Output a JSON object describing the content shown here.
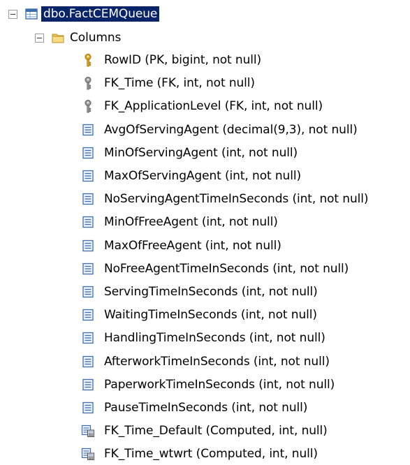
{
  "tree": {
    "table_node": {
      "label": "dbo.FactCEMQueue",
      "icon": "table-icon",
      "expanded": true,
      "selected": true
    },
    "columns_folder": {
      "label": "Columns",
      "icon": "folder-icon",
      "expanded": true
    },
    "columns": [
      {
        "label": "RowID (PK, bigint, not null)",
        "icon": "primary-key-icon"
      },
      {
        "label": "FK_Time (FK, int, not null)",
        "icon": "foreign-key-icon"
      },
      {
        "label": "FK_ApplicationLevel (FK, int, not null)",
        "icon": "foreign-key-icon"
      },
      {
        "label": "AvgOfServingAgent (decimal(9,3), not null)",
        "icon": "column-icon"
      },
      {
        "label": "MinOfServingAgent (int, not null)",
        "icon": "column-icon"
      },
      {
        "label": "MaxOfServingAgent (int, not null)",
        "icon": "column-icon"
      },
      {
        "label": "NoServingAgentTimeInSeconds (int, not null)",
        "icon": "column-icon"
      },
      {
        "label": "MinOfFreeAgent (int, not null)",
        "icon": "column-icon"
      },
      {
        "label": "MaxOfFreeAgent (int, not null)",
        "icon": "column-icon"
      },
      {
        "label": "NoFreeAgentTimeInSeconds (int, not null)",
        "icon": "column-icon"
      },
      {
        "label": "ServingTimeInSeconds (int, not null)",
        "icon": "column-icon"
      },
      {
        "label": "WaitingTimeInSeconds (int, not null)",
        "icon": "column-icon"
      },
      {
        "label": "HandlingTimeInSeconds (int, not null)",
        "icon": "column-icon"
      },
      {
        "label": "AfterworkTimeInSeconds (int, not null)",
        "icon": "column-icon"
      },
      {
        "label": "PaperworkTimeInSeconds (int, not null)",
        "icon": "column-icon"
      },
      {
        "label": "PauseTimeInSeconds (int, not null)",
        "icon": "column-icon"
      },
      {
        "label": "FK_Time_Default (Computed, int, null)",
        "icon": "computed-column-icon"
      },
      {
        "label": "FK_Time_wtwrt (Computed, int, null)",
        "icon": "computed-column-icon"
      }
    ]
  },
  "colors": {
    "selection": "#0a246a",
    "selection_text": "#ffffff",
    "text": "#000000",
    "background": "#ffffff",
    "key_gold": "#e0a81a",
    "key_gray": "#8a8a8a",
    "column_blue": "#3d6fb0",
    "folder_yellow": "#f2cd5c"
  }
}
